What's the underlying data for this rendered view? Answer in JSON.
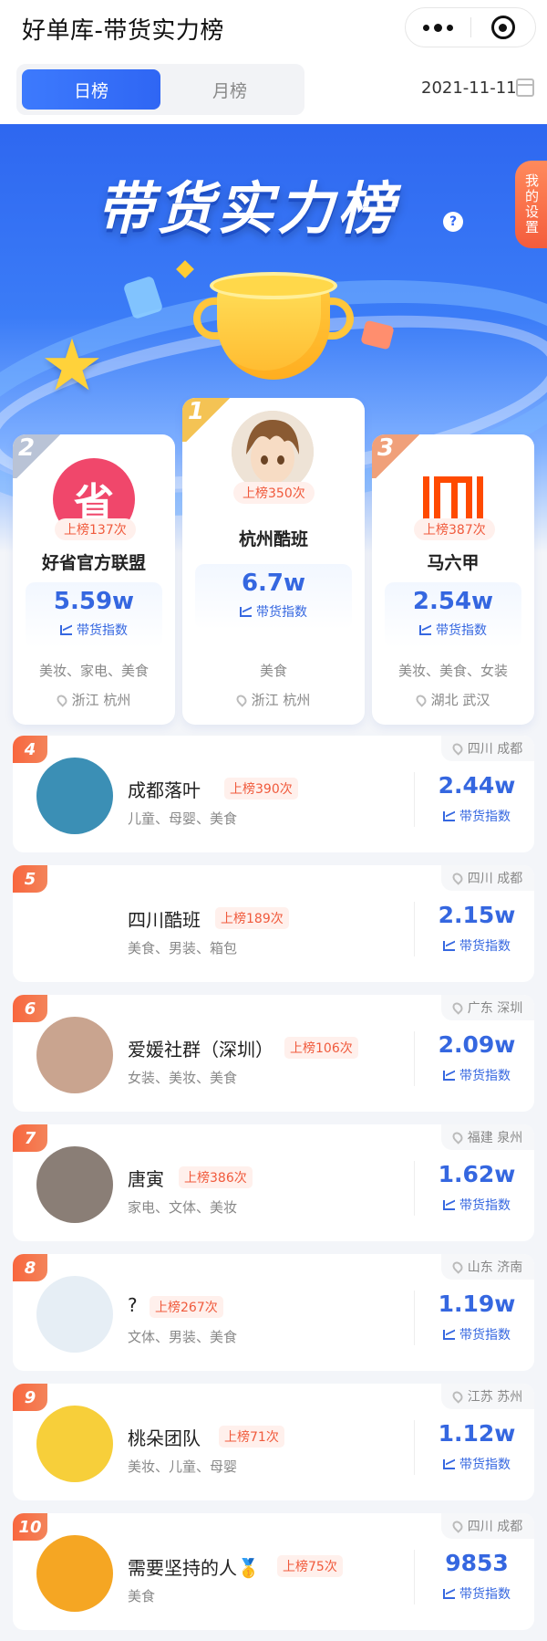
{
  "header": {
    "title": "好单库-带货实力榜"
  },
  "tabs": {
    "day": "日榜",
    "month": "月榜"
  },
  "date": "2021-11-11",
  "banner": {
    "title": "带货实力榜",
    "help": "?",
    "settings": "我的设置"
  },
  "index_label": "带货指数",
  "podium": [
    {
      "rank": "2",
      "badge": "上榜137次",
      "name": "好省官方联盟",
      "index": "5.59w",
      "tags": "美妆、家电、美食",
      "location": "浙江 杭州",
      "avatar_color": "#f0476b",
      "avatar_icon": "sheng-logo",
      "avatar_text": "省"
    },
    {
      "rank": "1",
      "badge": "上榜350次",
      "name": "杭州酷班",
      "index": "6.7w",
      "tags": "美食",
      "location": "浙江 杭州",
      "avatar_color": "#e8d9c7",
      "avatar_icon": "anime-boy-avatar"
    },
    {
      "rank": "3",
      "badge": "上榜387次",
      "name": "马六甲",
      "index": "2.54w",
      "tags": "美妆、美食、女装",
      "location": "湖北 武汉",
      "avatar_color": "#fff",
      "avatar_icon": "imi-logo"
    }
  ],
  "rows": [
    {
      "rank": "4",
      "name": "成都落叶",
      "badge": "上榜390次",
      "tags": "儿童、母婴、美食",
      "index": "2.44w",
      "location": "四川 成都",
      "avatar_color": "#3b8fb5",
      "avatar_icon": "wave-photo-avatar"
    },
    {
      "rank": "5",
      "name": "四川酷班",
      "badge": "上榜189次",
      "tags": "美食、男装、箱包",
      "index": "2.15w",
      "location": "四川 成都",
      "avatar_color": "#ffffff",
      "avatar_icon": "brand-text-avatar"
    },
    {
      "rank": "6",
      "name": "爱媛社群（深圳）",
      "badge": "上榜106次",
      "tags": "女装、美妆、美食",
      "index": "2.09w",
      "location": "广东 深圳",
      "avatar_color": "#c9a48f",
      "avatar_icon": "woman-photo-avatar"
    },
    {
      "rank": "7",
      "name": "唐寅",
      "badge": "上榜386次",
      "tags": "家电、文体、美妆",
      "index": "1.62w",
      "location": "福建 泉州",
      "avatar_color": "#8a7e76",
      "avatar_icon": "child-photo-avatar"
    },
    {
      "rank": "8",
      "name": "?",
      "badge": "上榜267次",
      "tags": "文体、男装、美食",
      "index": "1.19w",
      "location": "山东 济南",
      "avatar_color": "#e6eef5",
      "avatar_icon": "placeholder-image-avatar"
    },
    {
      "rank": "9",
      "name": "桃朵团队",
      "badge": "上榜71次",
      "tags": "美妆、儿童、母婴",
      "index": "1.12w",
      "location": "江苏 苏州",
      "avatar_color": "#f7cf3a",
      "avatar_icon": "cartoon-girl-avatar"
    },
    {
      "rank": "10",
      "name": "需要坚持的人🥇",
      "badge": "上榜75次",
      "tags": "美食",
      "index": "9853",
      "location": "四川 成都",
      "avatar_color": "#f5a623",
      "avatar_icon": "cartoon-man-avatar"
    }
  ]
}
